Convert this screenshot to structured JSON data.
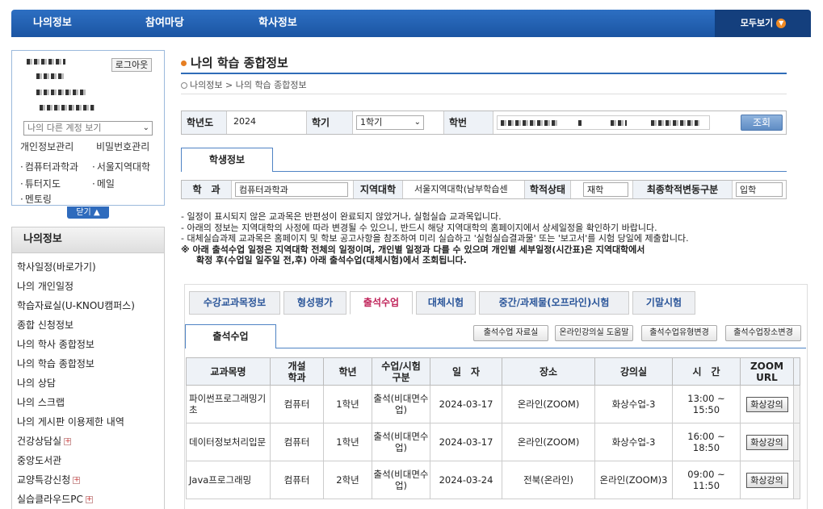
{
  "topnav": {
    "items": [
      "나의정보",
      "참여마당",
      "학사정보"
    ],
    "all_label": "모두보기"
  },
  "profile": {
    "logout_label": "로그아웃",
    "account_select": "나의 다른 계정 보기",
    "link_personal_info": "개인정보관리",
    "link_password": "비밀번호관리",
    "quick_links": [
      "컴퓨터과학과",
      "서울지역대학",
      "튜터지도",
      "메일",
      "멘토링"
    ],
    "close_label": "닫기"
  },
  "left_menu": {
    "heading": "나의정보",
    "items": [
      {
        "label": "학사일정(바로가기)",
        "expand": false
      },
      {
        "label": "나의 개인일정",
        "expand": false
      },
      {
        "label": "학습자료실(U-KNOU캠퍼스)",
        "expand": false
      },
      {
        "label": "종합 신청정보",
        "expand": false
      },
      {
        "label": "나의 학사 종합정보",
        "expand": false
      },
      {
        "label": "나의 학습 종합정보",
        "expand": false
      },
      {
        "label": "나의 상담",
        "expand": false
      },
      {
        "label": "나의 스크랩",
        "expand": false
      },
      {
        "label": "나의 게시판 이용제한 내역",
        "expand": false
      },
      {
        "label": "건강상담실",
        "expand": true
      },
      {
        "label": "중앙도서관",
        "expand": false
      },
      {
        "label": "교양특강신청",
        "expand": true
      },
      {
        "label": "실습클라우드PC",
        "expand": true
      }
    ]
  },
  "page": {
    "title": "나의 학습 종합정보",
    "breadcrumb": [
      "나의정보",
      "나의 학습 종합정보"
    ]
  },
  "search": {
    "year_label": "학년도",
    "year_value": "2024",
    "term_label": "학기",
    "term_value": "1학기",
    "id_label": "학번",
    "search_button": "조회"
  },
  "student": {
    "tab_label": "학생정보",
    "dept_label": "학　과",
    "dept_value": "컴퓨터과학과",
    "region_label": "지역대학",
    "region_value": "서울지역대학(남부학습센",
    "status_label": "학적상태",
    "status_value": "재학",
    "change_label": "최종학적변동구분",
    "change_value": "입학"
  },
  "notes": {
    "lines": [
      "- 일정이 표시되지 않은 교과목은 반편성이 완료되지 않았거나, 실험실습 교과목입니다.",
      "- 아래의 정보는 지역대학의 사정에 따라 변경될 수 있으니, 반드시 해당 지역대학의 홈페이지에서 상세일정을 확인하기 바랍니다.",
      "- 대체실습과제 교과목은 홈페이지 및 학보 공고사항을 참조하여 미리 실습하고 '실험실습결과물' 또는 '보고서'를 시험 당일에 제출합니다."
    ],
    "warning_line1": "※ 아래 출석수업 일정은 지역대학 전체의 일정이며, 개인별 일정과 다를 수 있으며 개인별 세부일정(시간표)은 지역대학에서",
    "warning_line2": "확정 후(수업일 일주일 전,후) 아래 출석수업(대체시험)에서 조회됩니다."
  },
  "tabs": [
    "수강교과목정보",
    "형성평가",
    "출석수업",
    "대체시험",
    "중간/과제물(오프라인)시험",
    "기말시험"
  ],
  "active_tab": "출석수업",
  "sub_tab": "출석수업",
  "action_buttons": [
    "출석수업 자료실",
    "온라인강의실 도움말",
    "출석수업유형변경",
    "출석수업장소변경"
  ],
  "table": {
    "headers": [
      "교과목명",
      "개설\n학과",
      "학년",
      "수업/시험\n구분",
      "일　자",
      "장소",
      "강의실",
      "시　간",
      "ZOOM\nURL"
    ],
    "rows": [
      {
        "course": "파이썬프로그래밍기초",
        "dept": "컴퓨터",
        "grade": "1학년",
        "type": "출석(비대면수업)",
        "date": "2024-03-17",
        "place": "온라인(ZOOM)",
        "room": "화상수업-3",
        "time": "13:00 ~ 15:50",
        "zoom": "화상강의"
      },
      {
        "course": "데이터정보처리입문",
        "dept": "컴퓨터",
        "grade": "1학년",
        "type": "출석(비대면수업)",
        "date": "2024-03-17",
        "place": "온라인(ZOOM)",
        "room": "화상수업-3",
        "time": "16:00 ~ 18:50",
        "zoom": "화상강의"
      },
      {
        "course": "Java프로그래밍",
        "dept": "컴퓨터",
        "grade": "2학년",
        "type": "출석(비대면수업)",
        "date": "2024-03-24",
        "place": "전북(온라인)",
        "room": "온라인(ZOOM)3",
        "time": "09:00 ~ 11:50",
        "zoom": "화상강의"
      }
    ]
  },
  "colors": {
    "nav_blue": "#1b55a3",
    "active_tab_text": "#c0245a",
    "accent_orange": "#e67e22"
  }
}
